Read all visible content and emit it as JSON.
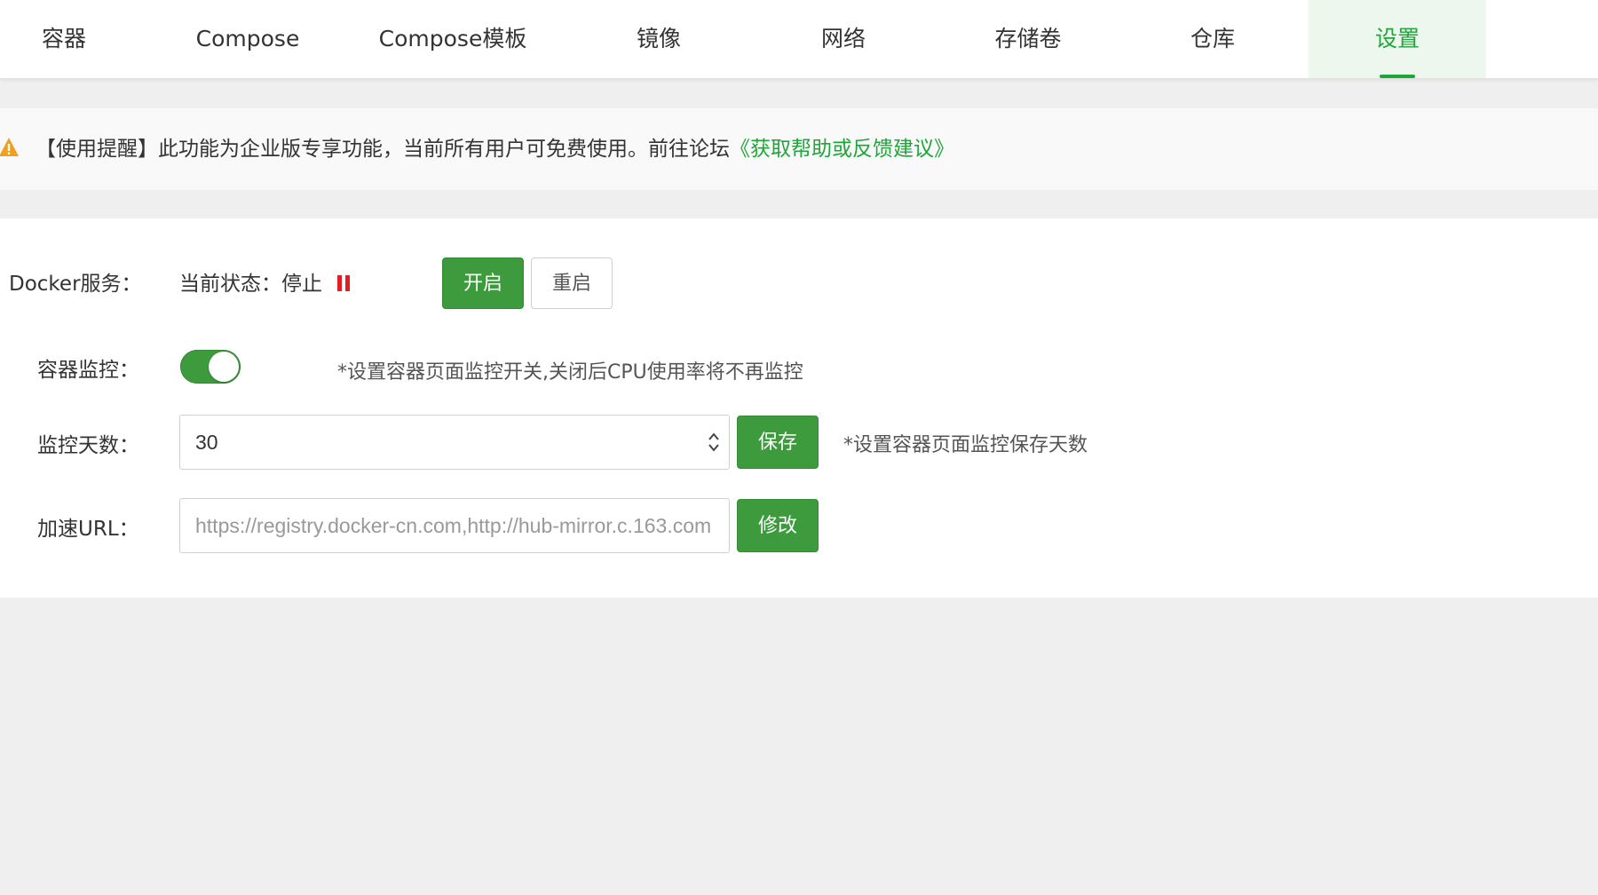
{
  "tabs": [
    {
      "label": "容器"
    },
    {
      "label": "Compose"
    },
    {
      "label": "Compose模板"
    },
    {
      "label": "镜像"
    },
    {
      "label": "网络"
    },
    {
      "label": "存储卷"
    },
    {
      "label": "仓库"
    },
    {
      "label": "设置",
      "active": true
    }
  ],
  "notice": {
    "icon": "warning-triangle-icon",
    "text": "【使用提醒】此功能为企业版专享功能，当前所有用户可免费使用。前往论坛",
    "link": "《获取帮助或反馈建议》"
  },
  "docker_service": {
    "label": "Docker服务：",
    "status_text": "当前状态：停止",
    "status_icon": "pause-icon",
    "start_button": "开启",
    "restart_button": "重启"
  },
  "monitor": {
    "label": "容器监控：",
    "enabled": true,
    "hint": "*设置容器页面监控开关,关闭后CPU使用率将不再监控"
  },
  "monitor_days": {
    "label": "监控天数：",
    "value": "30",
    "save_button": "保存",
    "hint": "*设置容器页面监控保存天数"
  },
  "mirror_url": {
    "label": "加速URL：",
    "value": "https://registry.docker-cn.com,http://hub-mirror.c.163.com",
    "edit_button": "修改"
  },
  "colors": {
    "accent": "#20a53a",
    "button_green": "#3d9a3d",
    "stop_red": "#e02020",
    "warning_orange": "#f0a020"
  }
}
